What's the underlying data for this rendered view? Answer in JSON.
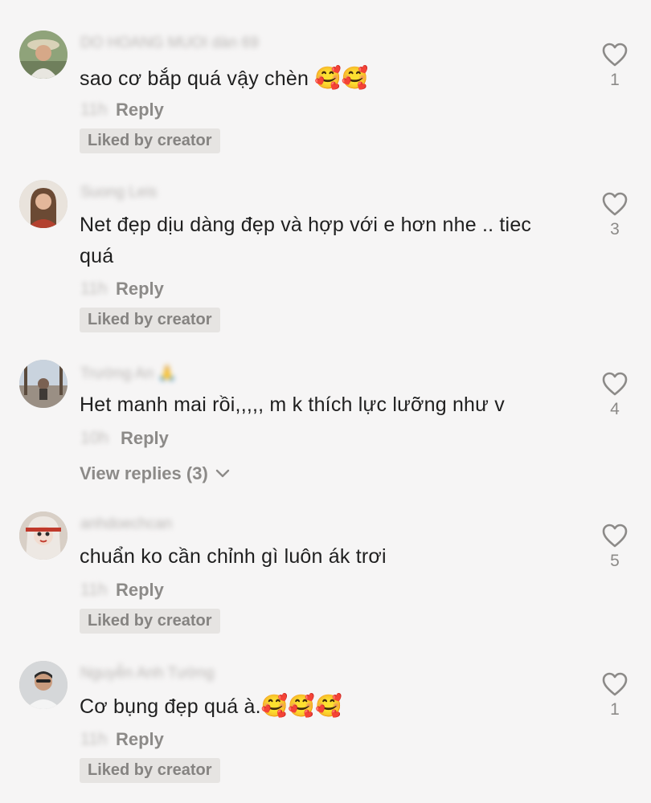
{
  "comments": [
    {
      "username": "DO HOANG MUOI dàn 69",
      "text": "sao cơ bắp quá vậy chèn ",
      "emoji": "🥰🥰",
      "timestamp": "11h",
      "reply_label": "Reply",
      "liked_badge": "Liked by creator",
      "likes": "1"
    },
    {
      "username": "Suong Leis",
      "text": "Net đẹp dịu dàng đẹp và hợp với e hơn nhe .. tiec quá",
      "emoji": "",
      "timestamp": "11h",
      "reply_label": "Reply",
      "liked_badge": "Liked by creator",
      "likes": "3"
    },
    {
      "username": "Trường An 🙏",
      "text": "Het manh mai rồi,,,,, m k thích lực lưỡng như v",
      "emoji": "",
      "timestamp": "10h",
      "reply_label": "Reply",
      "view_replies": "View replies (3)",
      "likes": "4"
    },
    {
      "username": "anhdoechcan",
      "text": "chuẩn ko cần chỉnh gì luôn ák trơi",
      "emoji": "",
      "timestamp": "11h",
      "reply_label": "Reply",
      "liked_badge": "Liked by creator",
      "likes": "5"
    },
    {
      "username": "Nguyễn Anh Tường",
      "text": "Cơ bụng đẹp quá à.",
      "emoji": "🥰🥰🥰",
      "timestamp": "11h",
      "reply_label": "Reply",
      "liked_badge": "Liked by creator",
      "likes": "1"
    }
  ],
  "colors": {
    "background": "#f6f5f5",
    "text": "#1f1f1f",
    "secondary": "#8c8a88",
    "badge_bg": "#e6e4e2"
  },
  "icons": {
    "like": "heart-outline-icon",
    "expand": "chevron-down-icon"
  }
}
